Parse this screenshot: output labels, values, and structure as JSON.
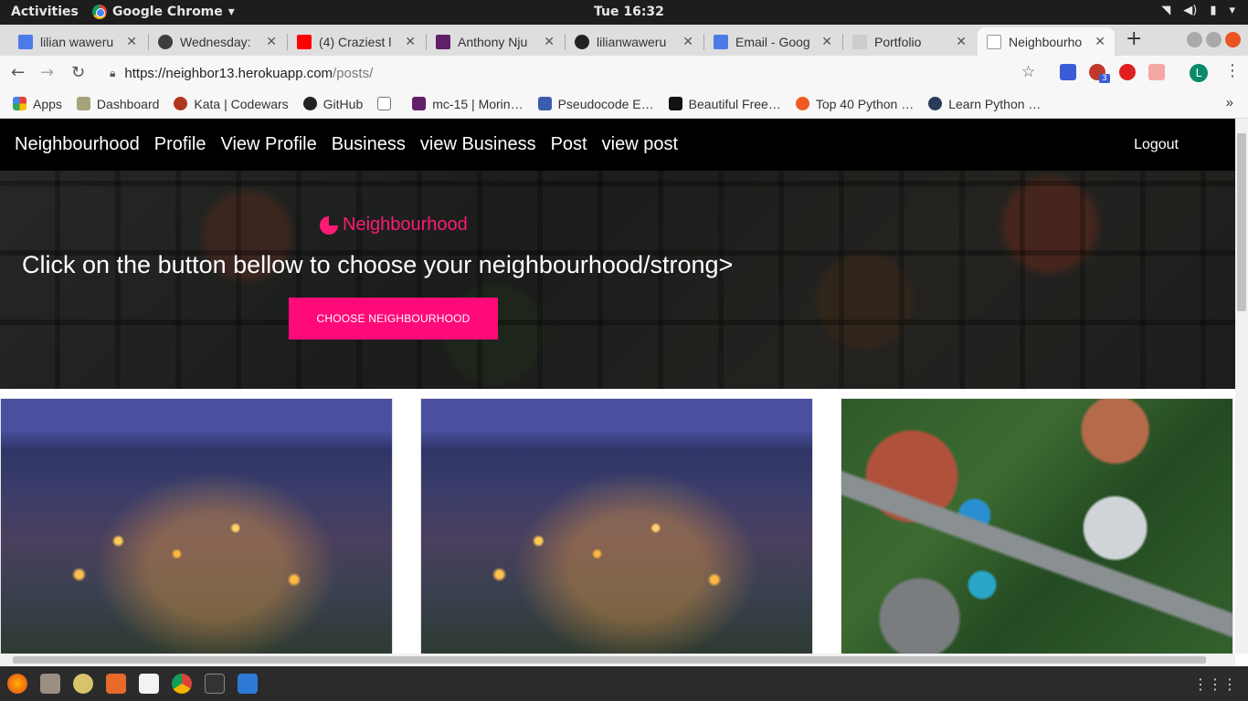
{
  "system": {
    "activities": "Activities",
    "app_name": "Google Chrome",
    "clock": "Tue 16:32"
  },
  "tabs": [
    {
      "title": "lilian waweru",
      "fav_color": "#4c7be8"
    },
    {
      "title": "Wednesday: ",
      "fav_color": "#3d3d3d"
    },
    {
      "title": "(4) Craziest l",
      "fav_color": "#ff0000"
    },
    {
      "title": "Anthony Nju",
      "fav_color": "#611f69"
    },
    {
      "title": "lilianwaweru",
      "fav_color": "#222222"
    },
    {
      "title": "Email - Goog",
      "fav_color": "#4c7be8"
    },
    {
      "title": "Portfolio",
      "fav_color": "#cccccc"
    },
    {
      "title": "Neighbourho",
      "fav_color": "#bbbbbb",
      "active": true
    }
  ],
  "address": {
    "host": "https://neighbor13.herokuapp.com",
    "path": "/posts/"
  },
  "profile_initial": "L",
  "extension_badge": "3",
  "bookmarks": [
    {
      "label": "Apps",
      "color": "#e94235"
    },
    {
      "label": "Dashboard",
      "color": "#a5a37a"
    },
    {
      "label": "Kata | Codewars",
      "color": "#b1361e"
    },
    {
      "label": "GitHub",
      "color": "#222222"
    },
    {
      "label": "",
      "color": "#ffffff"
    },
    {
      "label": "mc-15 | Morin…",
      "color": "#611f69"
    },
    {
      "label": "Pseudocode E…",
      "color": "#3b5cad"
    },
    {
      "label": "Beautiful Free…",
      "color": "#111111"
    },
    {
      "label": "Top 40 Python …",
      "color": "#f05a22"
    },
    {
      "label": "Learn Python …",
      "color": "#2a3a5a"
    }
  ],
  "site": {
    "nav": [
      "Neighbourhood",
      "Profile",
      "View Profile",
      "Business",
      "view Business",
      "Post",
      "view post"
    ],
    "logout": "Logout",
    "brand": "Neighbourhood",
    "headline": "Click on the button bellow to choose your neighbourhood/strong>",
    "cta": "CHOOSE NEIGHBOURHOOD",
    "accent": "#ff0a78"
  }
}
